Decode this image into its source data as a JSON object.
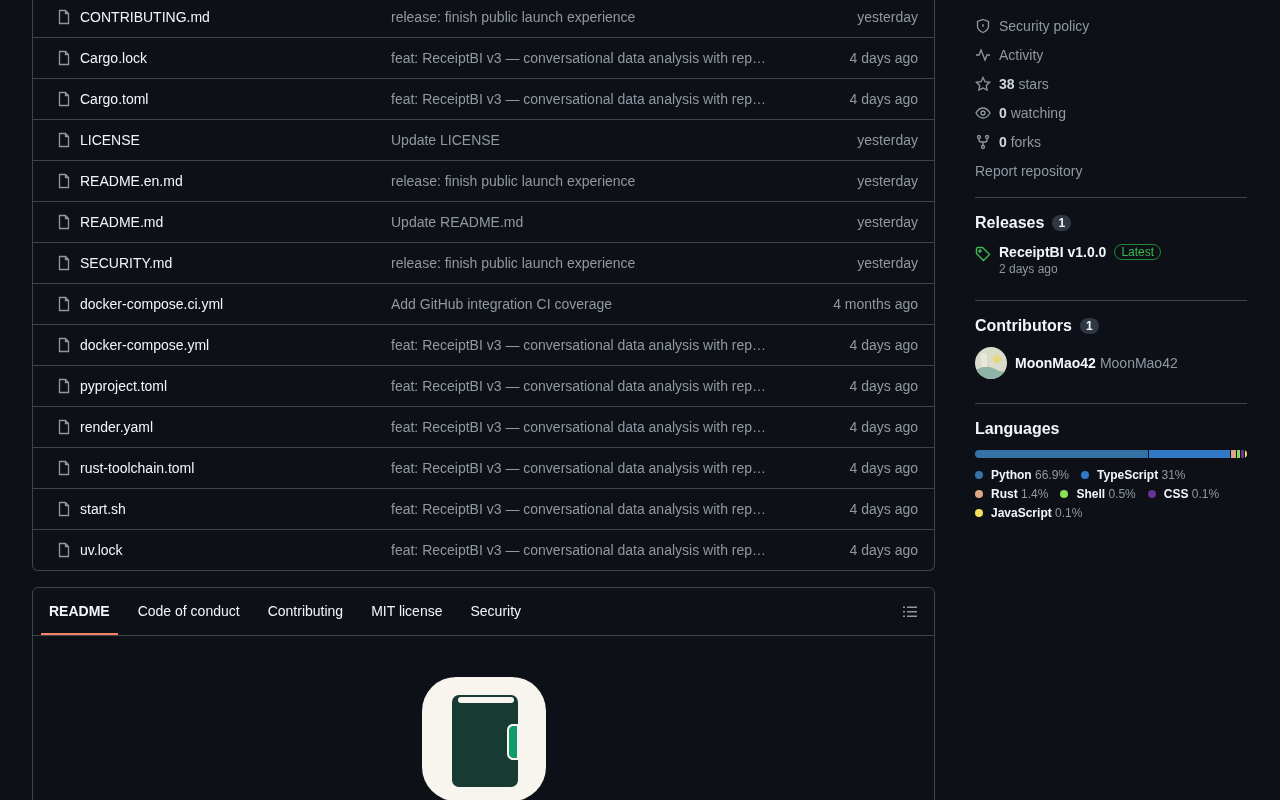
{
  "files": [
    {
      "name": "CONTRIBUTING.md",
      "message": "release: finish public launch experience",
      "date": "yesterday"
    },
    {
      "name": "Cargo.lock",
      "message": "feat: ReceiptBI v3 — conversational data analysis with rep…",
      "date": "4 days ago"
    },
    {
      "name": "Cargo.toml",
      "message": "feat: ReceiptBI v3 — conversational data analysis with rep…",
      "date": "4 days ago"
    },
    {
      "name": "LICENSE",
      "message": "Update LICENSE",
      "date": "yesterday"
    },
    {
      "name": "README.en.md",
      "message": "release: finish public launch experience",
      "date": "yesterday"
    },
    {
      "name": "README.md",
      "message": "Update README.md",
      "date": "yesterday"
    },
    {
      "name": "SECURITY.md",
      "message": "release: finish public launch experience",
      "date": "yesterday"
    },
    {
      "name": "docker-compose.ci.yml",
      "message": "Add GitHub integration CI coverage",
      "date": "4 months ago"
    },
    {
      "name": "docker-compose.yml",
      "message": "feat: ReceiptBI v3 — conversational data analysis with rep…",
      "date": "4 days ago"
    },
    {
      "name": "pyproject.toml",
      "message": "feat: ReceiptBI v3 — conversational data analysis with rep…",
      "date": "4 days ago"
    },
    {
      "name": "render.yaml",
      "message": "feat: ReceiptBI v3 — conversational data analysis with rep…",
      "date": "4 days ago"
    },
    {
      "name": "rust-toolchain.toml",
      "message": "feat: ReceiptBI v3 — conversational data analysis with rep…",
      "date": "4 days ago"
    },
    {
      "name": "start.sh",
      "message": "feat: ReceiptBI v3 — conversational data analysis with rep…",
      "date": "4 days ago"
    },
    {
      "name": "uv.lock",
      "message": "feat: ReceiptBI v3 — conversational data analysis with rep…",
      "date": "4 days ago"
    }
  ],
  "readme_tabs": [
    {
      "label": "README",
      "selected": true
    },
    {
      "label": "Code of conduct",
      "selected": false
    },
    {
      "label": "Contributing",
      "selected": false
    },
    {
      "label": "MIT license",
      "selected": false
    },
    {
      "label": "Security",
      "selected": false
    }
  ],
  "about_links": [
    {
      "kind": "shield",
      "label": "Security policy"
    },
    {
      "kind": "pulse",
      "label": "Activity"
    },
    {
      "kind": "star",
      "count": "38",
      "label": "stars"
    },
    {
      "kind": "eye",
      "count": "0",
      "label": "watching"
    },
    {
      "kind": "fork",
      "count": "0",
      "label": "forks"
    },
    {
      "kind": "plain",
      "label": "Report repository"
    }
  ],
  "releases": {
    "title": "Releases",
    "count": "1",
    "name": "ReceiptBI v1.0.0",
    "badge": "Latest",
    "date": "2 days ago"
  },
  "contributors": {
    "title": "Contributors",
    "count": "1",
    "login": "MoonMao42",
    "name": "MoonMao42"
  },
  "languages": {
    "title": "Languages",
    "items": [
      {
        "name": "Python",
        "percent": "66.9%",
        "color": "#3572a5"
      },
      {
        "name": "TypeScript",
        "percent": "31%",
        "color": "#3178c6"
      },
      {
        "name": "Rust",
        "percent": "1.4%",
        "color": "#dea584"
      },
      {
        "name": "Shell",
        "percent": "0.5%",
        "color": "#89e051"
      },
      {
        "name": "CSS",
        "percent": "0.1%",
        "color": "#663399"
      },
      {
        "name": "JavaScript",
        "percent": "0.1%",
        "color": "#f1e05a"
      }
    ]
  }
}
